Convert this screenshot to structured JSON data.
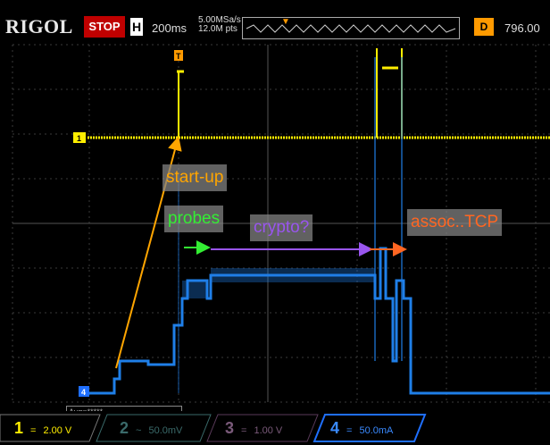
{
  "header": {
    "brand": "RIGOL",
    "run_status": "STOP",
    "horizontal_label": "H",
    "timebase": "200ms",
    "sample_rate": "5.00MSa/s",
    "memory_depth": "12.0M pts",
    "delay_label": "D",
    "delay_value": "796.00"
  },
  "annotations": {
    "startup": "start-up",
    "probes": "probes",
    "crypto": "crypto?",
    "assoc": "assoc..TCP"
  },
  "status": {
    "avg": "Avg=*****"
  },
  "channels": [
    {
      "num": "1",
      "coupling": "=",
      "scale": "2.00 V",
      "color": "#ffee00"
    },
    {
      "num": "2",
      "coupling": "~",
      "scale": "50.0mV",
      "color": "#3a6a6a"
    },
    {
      "num": "3",
      "coupling": "=",
      "scale": "1.00 V",
      "color": "#5a3a5a"
    },
    {
      "num": "4",
      "coupling": "=",
      "scale": "50.0mA",
      "color": "#1f6fff"
    }
  ],
  "colors": {
    "ch1_trace": "#ffee00",
    "ch4_trace": "#1f7fe8",
    "grid": "#3a3a3a",
    "trigger": "#ff9a00",
    "startup_arrow": "#ffa500",
    "probes_arrow": "#33ee33",
    "crypto_arrow": "#9955ee",
    "assoc_arrow": "#ff6622"
  }
}
